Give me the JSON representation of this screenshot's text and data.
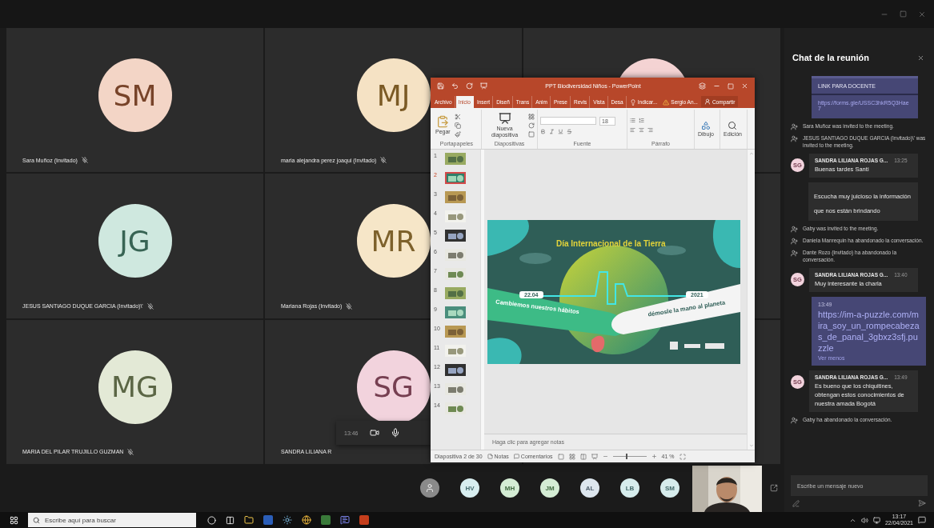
{
  "gallery": {
    "rows": [
      {
        "tiles": [
          {
            "initials": "SM",
            "name": "Sara Muñoz (Invitado)",
            "muted": true,
            "color": "#f3d5c6"
          },
          {
            "initials": "MJ",
            "name": "maria alejandra perez joaqui (Invitado)",
            "muted": true,
            "color": "#f5e2c4"
          },
          {
            "color": "#f4d3d3"
          }
        ]
      },
      {
        "tiles": [
          {
            "initials": "JG",
            "name": "JESUS SANTIAGO DUQUE GARCIA (Invitado)\\'",
            "muted": true,
            "color": "#cfe8df"
          },
          {
            "initials": "MR",
            "name": "Mariana Rojas (Invitado)",
            "muted": true,
            "color": "#f6e6c8"
          }
        ]
      },
      {
        "tiles": [
          {
            "initials": "MG",
            "name": "MARIA DEL PILAR TRUJILLO GUZMAN",
            "muted": true,
            "color": "#e3e9d6"
          },
          {
            "initials": "SG",
            "name": "SANDRA LILIANA R",
            "muted": false,
            "color": "#f2d3dd"
          }
        ]
      }
    ]
  },
  "call_controls": {
    "time": "13:46"
  },
  "participants": [
    {
      "kind": "person",
      "color": "#8a8a8a"
    },
    {
      "kind": "initials",
      "initials": "HV",
      "color": "#d8eef0"
    },
    {
      "kind": "initials",
      "initials": "MH",
      "color": "#d4ecd4"
    },
    {
      "kind": "initials",
      "initials": "JM",
      "color": "#d4ecd4"
    },
    {
      "kind": "initials",
      "initials": "AL",
      "color": "#dde6ee"
    },
    {
      "kind": "initials",
      "initials": "LB",
      "color": "#d6ecec"
    },
    {
      "kind": "initials",
      "initials": "SM",
      "color": "#d6ecec"
    }
  ],
  "powerpoint": {
    "title": "PPT Biodiversidad Niños - PowerPoint",
    "tabs": [
      {
        "label": "Archivo",
        "selected": false
      },
      {
        "label": "Inicio",
        "selected": true
      },
      {
        "label": "Insert",
        "selected": false
      },
      {
        "label": "Diseñ",
        "selected": false
      },
      {
        "label": "Trans",
        "selected": false
      },
      {
        "label": "Anim",
        "selected": false
      },
      {
        "label": "Prese",
        "selected": false
      },
      {
        "label": "Revis",
        "selected": false
      },
      {
        "label": "Vista",
        "selected": false
      },
      {
        "label": "Desa",
        "selected": false
      }
    ],
    "tell_me": "Indicar...",
    "user": "Sergio An...",
    "share": "Compartir",
    "ribbon": {
      "paste": "Pegar",
      "new_slide": "Nueva diapositiva",
      "font_size": "18",
      "drawing": "Dibujo",
      "editing": "Edición",
      "groups": [
        "Portapapeles",
        "Diapositivas",
        "Fuente",
        "Párrafo"
      ]
    },
    "slides": [
      {
        "number": "1",
        "selected": false
      },
      {
        "number": "2",
        "selected": true
      },
      {
        "number": "3",
        "selected": false
      },
      {
        "number": "4",
        "selected": false
      },
      {
        "number": "5",
        "selected": false
      },
      {
        "number": "6",
        "selected": false
      },
      {
        "number": "7",
        "selected": false
      },
      {
        "number": "8",
        "selected": false
      },
      {
        "number": "9",
        "selected": false
      },
      {
        "number": "10",
        "selected": false
      },
      {
        "number": "11",
        "selected": false
      },
      {
        "number": "12",
        "selected": false
      },
      {
        "number": "13",
        "selected": false
      },
      {
        "number": "14",
        "selected": false
      }
    ],
    "slide": {
      "title": "Día Internacional de la Tierra",
      "date": "22.04",
      "year": "2021",
      "left_text": "Cambiemos nuestros hábitos",
      "right_text": "démosle la mano al planeta"
    },
    "notes_placeholder": "Haga clic para agregar notas",
    "status": {
      "slide_count": "Diapositiva 2 de 30",
      "notes": "Notas",
      "comments": "Comentarios",
      "zoom": "41 %",
      "zoom_slider": {
        "level": 0.4
      }
    }
  },
  "chat": {
    "title": "Chat de la reunión",
    "items": [
      {
        "kind": "card",
        "heading": "LINK PARA DOCENTE",
        "link": "https://forms.gle/USSC3hkR5Q3Hae7"
      },
      {
        "kind": "system",
        "text": "Sara Muñoz was invited to the meeting."
      },
      {
        "kind": "system",
        "text": "JESUS SANTIAGO DUQUE GARCIA (Invitado)\\' was invited to the meeting."
      },
      {
        "kind": "message",
        "initials": "SG",
        "color": "#f2d3dd",
        "author": "SANDRA LILIANA ROJAS G...",
        "time": "13:25",
        "text": "Buenas tardes Santi"
      },
      {
        "kind": "continuation",
        "text": "Escucha muy juicioso la información que nos están brindando"
      },
      {
        "kind": "system",
        "text": "Gaby was invited to the meeting."
      },
      {
        "kind": "system",
        "text": "Daniela Manrequin ha abandonado la conversación."
      },
      {
        "kind": "system",
        "text": "Dante Rozo (Invitado) ha abandonado la conversación."
      },
      {
        "kind": "message",
        "initials": "SG",
        "color": "#f2d3dd",
        "author": "SANDRA LILIANA ROJAS G...",
        "time": "13:40",
        "text": "Muy interesante la charla"
      },
      {
        "kind": "link",
        "time": "13:49",
        "link": "https://im-a-puzzle.com/mira_soy_un_rompecabezas_de_panal_3gbxz3sfj.puzzle",
        "more": "Ver menos"
      },
      {
        "kind": "message",
        "initials": "SG",
        "color": "#f2d3dd",
        "author": "SANDRA LILIANA ROJAS G...",
        "time": "13:49",
        "text": "Es bueno que los chiquitines, obtengan estos conocimientos de nuestra amada Bogotá"
      },
      {
        "kind": "system",
        "text": "Gaby ha abandonado la conversación."
      }
    ],
    "input_placeholder": "Escribe un mensaje nuevo"
  },
  "taskbar": {
    "search_placeholder": "Escribe aquí para buscar",
    "time": "13:17",
    "date": "22/04/2021"
  }
}
